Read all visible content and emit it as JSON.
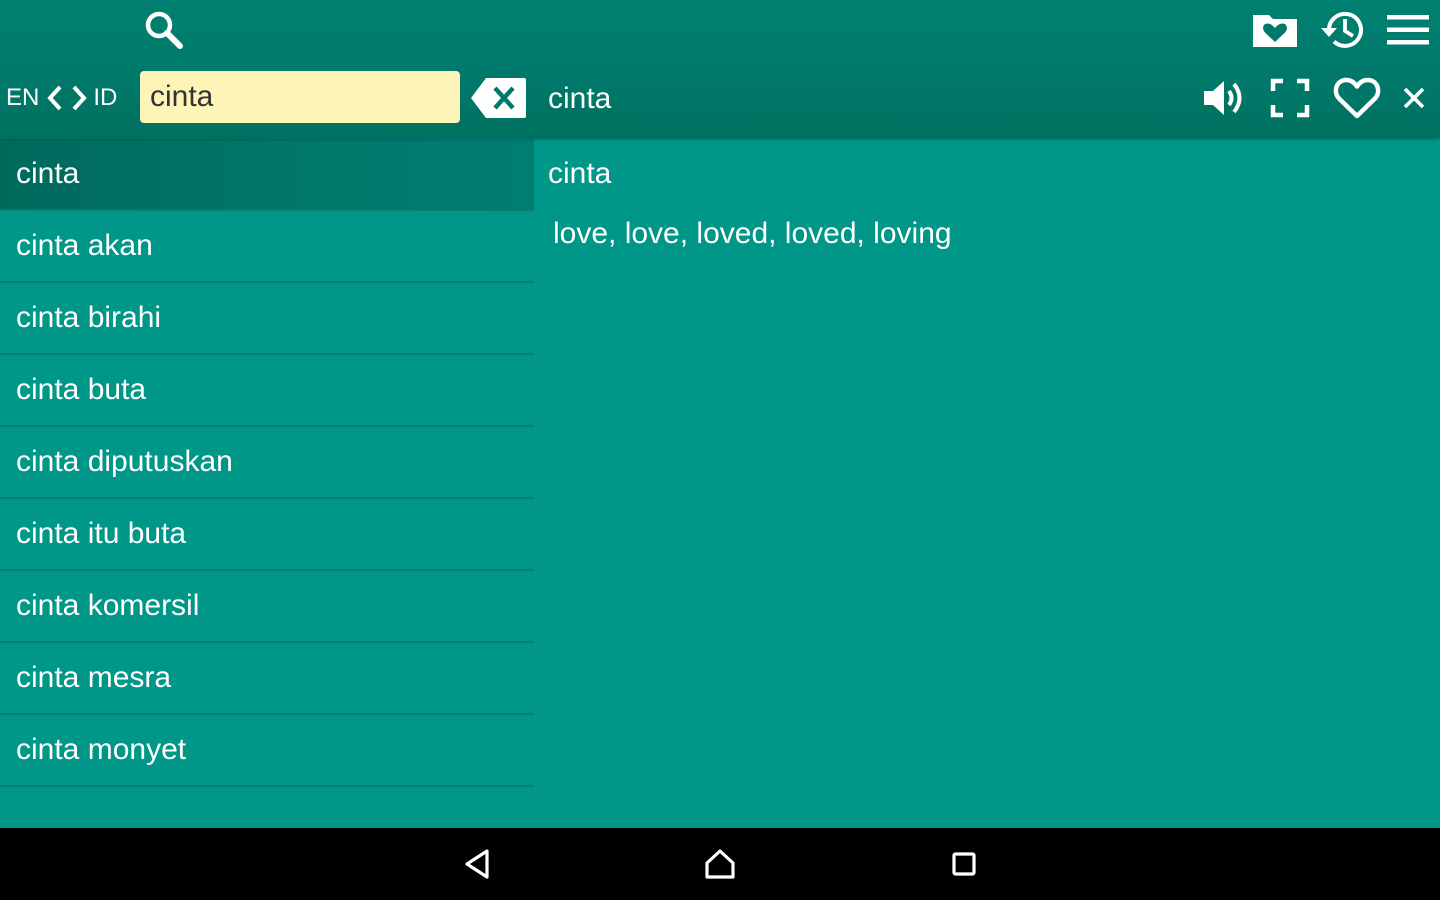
{
  "toolbar": {
    "icons": {
      "search": "search-icon",
      "favorites_folder": "favorites-folder-icon",
      "history": "history-icon",
      "menu": "menu-icon",
      "clear": "backspace-clear-icon",
      "speaker": "speaker-icon",
      "fullscreen": "fullscreen-icon",
      "favorite": "heart-outline-icon",
      "close": "close-icon"
    },
    "lang_from": "EN",
    "lang_to": "ID",
    "search_value": "cinta",
    "current_word": "cinta"
  },
  "word_list": {
    "items": [
      {
        "label": "cinta",
        "selected": true
      },
      {
        "label": "cinta akan"
      },
      {
        "label": "cinta birahi"
      },
      {
        "label": "cinta buta"
      },
      {
        "label": "cinta diputuskan"
      },
      {
        "label": "cinta itu buta"
      },
      {
        "label": "cinta komersil"
      },
      {
        "label": "cinta mesra"
      },
      {
        "label": "cinta monyet"
      }
    ]
  },
  "detail": {
    "headword": "cinta",
    "translation": "love, love, loved, loved, loving"
  },
  "colors": {
    "toolbar": "#00796b",
    "content": "#009688",
    "selected_row": "#00695c",
    "search_field": "#fff4b8",
    "navbar": "#000000"
  },
  "navbar": {
    "icons": [
      "back-icon",
      "home-icon",
      "recents-icon"
    ]
  }
}
